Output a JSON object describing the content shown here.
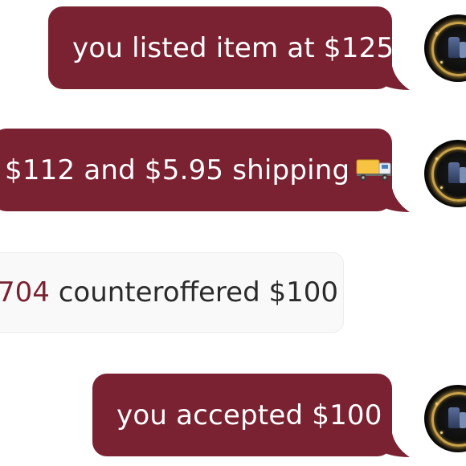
{
  "conversation": {
    "messages": [
      {
        "text": "you listed item at $125"
      },
      {
        "text": "$112 and $5.95 shipping",
        "icon": "delivery-truck-emoji"
      },
      {
        "username_fragment": "704",
        "action": "counteroffered $100"
      },
      {
        "text": "you accepted $100"
      }
    ]
  },
  "colors": {
    "outgoing_bubble": "#7b2232",
    "outgoing_text": "#ffffff",
    "incoming_bubble": "#f9f9f9",
    "incoming_text": "#2b2b2b",
    "username": "#7b2232",
    "avatar_accent": "#c9a24a"
  }
}
